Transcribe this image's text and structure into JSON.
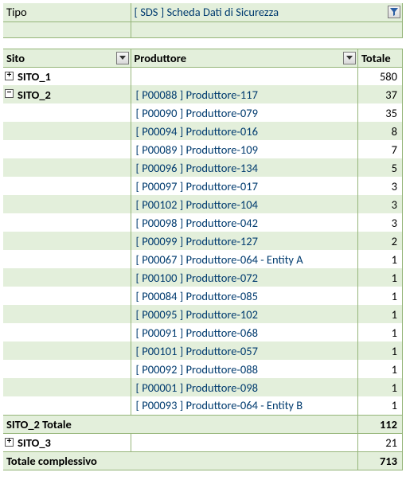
{
  "filter": {
    "field_label": "Tipo",
    "value": "[ SDS ] Scheda Dati di Sicurezza"
  },
  "headers": {
    "sito": "Sito",
    "produttore": "Produttore",
    "totale": "Totale"
  },
  "groups": [
    {
      "name": "SITO_1",
      "expanded": false,
      "total": 580,
      "rows": []
    },
    {
      "name": "SITO_2",
      "expanded": true,
      "total": 112,
      "total_label": "SITO_2 Totale",
      "rows": [
        {
          "producer": "[ P00088 ] Produttore-117",
          "value": 37
        },
        {
          "producer": "[ P00090 ] Produttore-079",
          "value": 35
        },
        {
          "producer": "[ P00094 ] Produttore-016",
          "value": 8
        },
        {
          "producer": "[ P00089 ] Produttore-109",
          "value": 7
        },
        {
          "producer": "[ P00096 ] Produttore-134",
          "value": 5
        },
        {
          "producer": "[ P00097 ] Produttore-017",
          "value": 3
        },
        {
          "producer": "[ P00102 ] Produttore-104",
          "value": 3
        },
        {
          "producer": "[ P00098 ] Produttore-042",
          "value": 3
        },
        {
          "producer": "[ P00099 ] Produttore-127",
          "value": 2
        },
        {
          "producer": "[ P00067 ] Produttore-064 - Entity A",
          "value": 1
        },
        {
          "producer": "[ P00100 ] Produttore-072",
          "value": 1
        },
        {
          "producer": "[ P00084 ] Produttore-085",
          "value": 1
        },
        {
          "producer": "[ P00095 ] Produttore-102",
          "value": 1
        },
        {
          "producer": "[ P00091 ] Produttore-068",
          "value": 1
        },
        {
          "producer": "[ P00101 ] Produttore-057",
          "value": 1
        },
        {
          "producer": "[ P00092 ] Produttore-088",
          "value": 1
        },
        {
          "producer": "[ P00001 ] Produttore-098",
          "value": 1
        },
        {
          "producer": "[ P00093 ] Produttore-064 - Entity B",
          "value": 1
        }
      ]
    },
    {
      "name": "SITO_3",
      "expanded": false,
      "total": 21,
      "rows": []
    }
  ],
  "grand_total": {
    "label": "Totale complessivo",
    "value": 713
  },
  "chart_data": {
    "type": "table",
    "title": "",
    "filter": {
      "Tipo": "[ SDS ] Scheda Dati di Sicurezza"
    },
    "columns": [
      "Sito",
      "Produttore",
      "Totale"
    ],
    "groups": {
      "SITO_1": {
        "total": 580
      },
      "SITO_2": {
        "total": 112,
        "breakdown": {
          "[ P00088 ] Produttore-117": 37,
          "[ P00090 ] Produttore-079": 35,
          "[ P00094 ] Produttore-016": 8,
          "[ P00089 ] Produttore-109": 7,
          "[ P00096 ] Produttore-134": 5,
          "[ P00097 ] Produttore-017": 3,
          "[ P00102 ] Produttore-104": 3,
          "[ P00098 ] Produttore-042": 3,
          "[ P00099 ] Produttore-127": 2,
          "[ P00067 ] Produttore-064 - Entity A": 1,
          "[ P00100 ] Produttore-072": 1,
          "[ P00084 ] Produttore-085": 1,
          "[ P00095 ] Produttore-102": 1,
          "[ P00091 ] Produttore-068": 1,
          "[ P00101 ] Produttore-057": 1,
          "[ P00092 ] Produttore-088": 1,
          "[ P00001 ] Produttore-098": 1,
          "[ P00093 ] Produttore-064 - Entity B": 1
        }
      },
      "SITO_3": {
        "total": 21
      }
    },
    "grand_total": 713
  }
}
